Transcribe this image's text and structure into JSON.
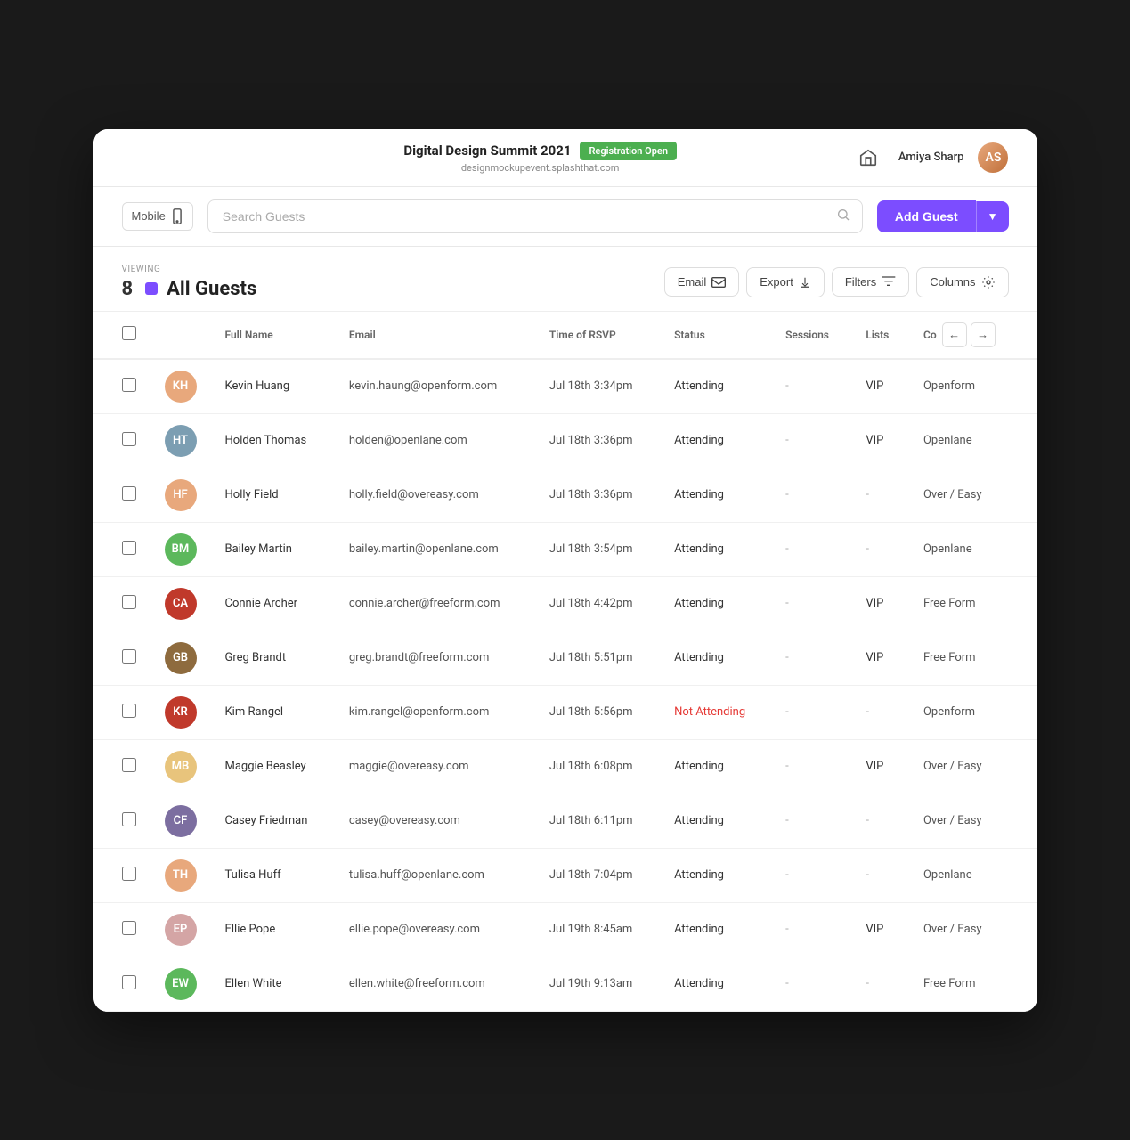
{
  "topBar": {
    "eventTitle": "Digital Design Summit 2021",
    "regBadge": "Registration Open",
    "eventUrl": "designmockupevent.splashthat.com",
    "userName": "Amiya Sharp"
  },
  "toolbar": {
    "mobileLabel": "Mobile",
    "searchPlaceholder": "Search Guests",
    "addGuestLabel": "Add Guest"
  },
  "guestsHeader": {
    "viewingLabel": "VIEWING",
    "title": "All Guests",
    "count": "8",
    "emailLabel": "Email",
    "exportLabel": "Export",
    "filtersLabel": "Filters",
    "columnsLabel": "Columns"
  },
  "table": {
    "columns": [
      {
        "id": "checkbox",
        "label": ""
      },
      {
        "id": "avatar",
        "label": ""
      },
      {
        "id": "fullName",
        "label": "Full Name"
      },
      {
        "id": "email",
        "label": "Email"
      },
      {
        "id": "timeOfRsvp",
        "label": "Time of RSVP"
      },
      {
        "id": "status",
        "label": "Status"
      },
      {
        "id": "sessions",
        "label": "Sessions"
      },
      {
        "id": "lists",
        "label": "Lists"
      },
      {
        "id": "company",
        "label": "Co"
      }
    ],
    "rows": [
      {
        "id": 1,
        "fullName": "Kevin Huang",
        "email": "kevin.haung@openform.com",
        "timeOfRsvp": "Jul 18th 3:34pm",
        "status": "Attending",
        "sessions": "-",
        "lists": "VIP",
        "company": "Openform",
        "avatarColor": "#e8a87c",
        "initials": "KH"
      },
      {
        "id": 2,
        "fullName": "Holden Thomas",
        "email": "holden@openlane.com",
        "timeOfRsvp": "Jul 18th 3:36pm",
        "status": "Attending",
        "sessions": "-",
        "lists": "VIP",
        "company": "Openlane",
        "avatarColor": "#7c9eb2",
        "initials": "HT"
      },
      {
        "id": 3,
        "fullName": "Holly Field",
        "email": "holly.field@overeasy.com",
        "timeOfRsvp": "Jul 18th 3:36pm",
        "status": "Attending",
        "sessions": "-",
        "lists": "-",
        "company": "Over / Easy",
        "avatarColor": "#e8a87c",
        "initials": "HF"
      },
      {
        "id": 4,
        "fullName": "Bailey Martin",
        "email": "bailey.martin@openlane.com",
        "timeOfRsvp": "Jul 18th 3:54pm",
        "status": "Attending",
        "sessions": "-",
        "lists": "-",
        "company": "Openlane",
        "avatarColor": "#5cb85c",
        "initials": "BM"
      },
      {
        "id": 5,
        "fullName": "Connie Archer",
        "email": "connie.archer@freeform.com",
        "timeOfRsvp": "Jul 18th 4:42pm",
        "status": "Attending",
        "sessions": "-",
        "lists": "VIP",
        "company": "Free Form",
        "avatarColor": "#c0392b",
        "initials": "CA"
      },
      {
        "id": 6,
        "fullName": "Greg Brandt",
        "email": "greg.brandt@freeform.com",
        "timeOfRsvp": "Jul 18th 5:51pm",
        "status": "Attending",
        "sessions": "-",
        "lists": "VIP",
        "company": "Free Form",
        "avatarColor": "#8e6b3e",
        "initials": "GB"
      },
      {
        "id": 7,
        "fullName": "Kim Rangel",
        "email": "kim.rangel@openform.com",
        "timeOfRsvp": "Jul 18th 5:56pm",
        "status": "Not Attending",
        "sessions": "-",
        "lists": "-",
        "company": "Openform",
        "avatarColor": "#c0392b",
        "initials": "KR"
      },
      {
        "id": 8,
        "fullName": "Maggie Beasley",
        "email": "maggie@overeasy.com",
        "timeOfRsvp": "Jul 18th 6:08pm",
        "status": "Attending",
        "sessions": "-",
        "lists": "VIP",
        "company": "Over / Easy",
        "avatarColor": "#e8c47c",
        "initials": "MB"
      },
      {
        "id": 9,
        "fullName": "Casey Friedman",
        "email": "casey@overeasy.com",
        "timeOfRsvp": "Jul 18th 6:11pm",
        "status": "Attending",
        "sessions": "-",
        "lists": "-",
        "company": "Over / Easy",
        "avatarColor": "#7c6ea0",
        "initials": "CF"
      },
      {
        "id": 10,
        "fullName": "Tulisa Huff",
        "email": "tulisa.huff@openlane.com",
        "timeOfRsvp": "Jul 18th 7:04pm",
        "status": "Attending",
        "sessions": "-",
        "lists": "-",
        "company": "Openlane",
        "avatarColor": "#e8a87c",
        "initials": "TH"
      },
      {
        "id": 11,
        "fullName": "Ellie Pope",
        "email": "ellie.pope@overeasy.com",
        "timeOfRsvp": "Jul 19th 8:45am",
        "status": "Attending",
        "sessions": "-",
        "lists": "VIP",
        "company": "Over / Easy",
        "avatarColor": "#d4a5a5",
        "initials": "EP"
      },
      {
        "id": 12,
        "fullName": "Ellen White",
        "email": "ellen.white@freeform.com",
        "timeOfRsvp": "Jul 19th 9:13am",
        "status": "Attending",
        "sessions": "-",
        "lists": "-",
        "company": "Free Form",
        "avatarColor": "#5cb85c",
        "initials": "EW"
      }
    ]
  }
}
